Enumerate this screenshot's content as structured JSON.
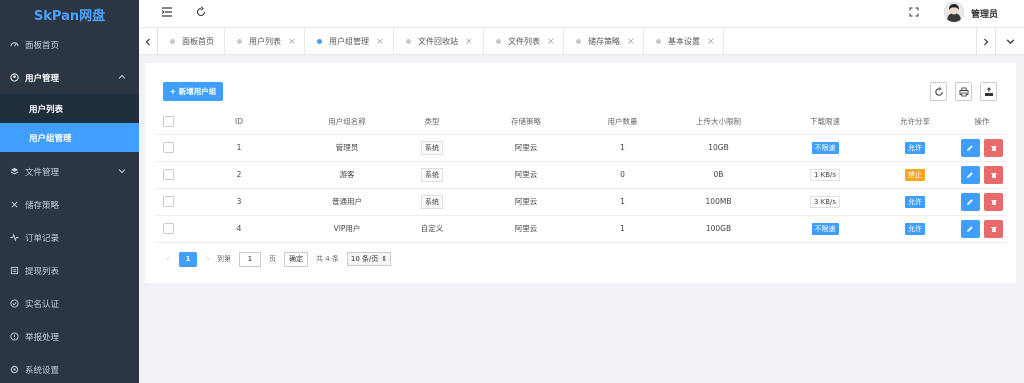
{
  "app": {
    "logo": "SkPan网盘"
  },
  "sidebar": {
    "items": [
      {
        "label": "面板首页",
        "icon": "dashboard-icon"
      },
      {
        "label": "用户管理",
        "icon": "user-circle-icon",
        "open": true,
        "children": [
          {
            "label": "用户列表"
          },
          {
            "label": "用户组管理",
            "active": true
          }
        ]
      },
      {
        "label": "文件管理",
        "icon": "layers-icon"
      },
      {
        "label": "储存策略",
        "icon": "strategy-icon"
      },
      {
        "label": "订单记录",
        "icon": "pulse-icon"
      },
      {
        "label": "提现列表",
        "icon": "list-box-icon"
      },
      {
        "label": "实名认证",
        "icon": "verified-icon"
      },
      {
        "label": "举报处理",
        "icon": "alert-icon"
      },
      {
        "label": "系统设置",
        "icon": "settings-icon"
      }
    ]
  },
  "header": {
    "admin_name": "管理员"
  },
  "tabs": [
    {
      "label": "面板首页",
      "closable": false
    },
    {
      "label": "用户列表",
      "closable": true
    },
    {
      "label": "用户组管理",
      "closable": true,
      "active": true
    },
    {
      "label": "文件回收站",
      "closable": true
    },
    {
      "label": "文件列表",
      "closable": true
    },
    {
      "label": "储存策略",
      "closable": true
    },
    {
      "label": "基本设置",
      "closable": true
    }
  ],
  "toolbar": {
    "add_label": "+ 新增用户组"
  },
  "table": {
    "headers": [
      "",
      "ID",
      "用户组名称",
      "类型",
      "存储策略",
      "用户数量",
      "上传大小限制",
      "下载限速",
      "允许分享",
      "操作"
    ],
    "rows": [
      {
        "id": "1",
        "name": "管理员",
        "type": "系统",
        "storage": "阿里云",
        "users": "1",
        "upload": "10GB",
        "speed": "不限速",
        "speed_style": "blue",
        "share": "允许",
        "share_style": "blue"
      },
      {
        "id": "2",
        "name": "游客",
        "type": "系统",
        "storage": "阿里云",
        "users": "0",
        "upload": "0B",
        "speed": "1 KB/s",
        "speed_style": "plain",
        "share": "禁止",
        "share_style": "yellow"
      },
      {
        "id": "3",
        "name": "普通用户",
        "type": "系统",
        "storage": "阿里云",
        "users": "1",
        "upload": "100MB",
        "speed": "3 KB/s",
        "speed_style": "plain",
        "share": "允许",
        "share_style": "blue"
      },
      {
        "id": "4",
        "name": "VIP用户",
        "type": "自定义",
        "storage": "阿里云",
        "users": "1",
        "upload": "100GB",
        "speed": "不限速",
        "speed_style": "blue",
        "share": "允许",
        "share_style": "blue"
      }
    ]
  },
  "pager": {
    "current": "1",
    "goto_label": "到第",
    "goto_value": "1",
    "page_unit": "页",
    "confirm": "确定",
    "total": "共 4 条",
    "page_size": "10 条/页"
  }
}
